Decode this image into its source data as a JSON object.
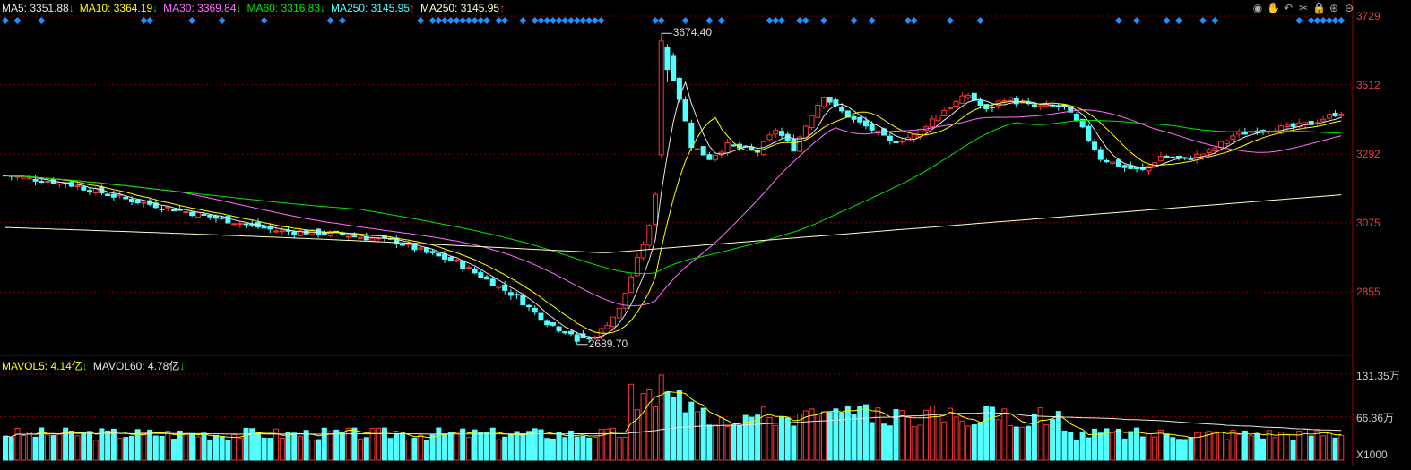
{
  "colors": {
    "up": "#ff3232",
    "down": "#54ffff",
    "ma5": "#e8e8e8",
    "ma10": "#ffff00",
    "ma30": "#ff6eff",
    "ma60": "#00e600",
    "ma250": "#ffffc8",
    "grid": "#7a0000",
    "axis": "#a00000",
    "marker": "#1e90ff"
  },
  "legend": {
    "price": [
      {
        "label": "MA5: 3351.88",
        "arrow": "↓",
        "color": "#e8e8e8"
      },
      {
        "label": "MA10: 3364.19",
        "arrow": "↓",
        "color": "#ffff00"
      },
      {
        "label": "MA30: 3369.84",
        "arrow": "↓",
        "color": "#ff6eff"
      },
      {
        "label": "MA60: 3316.83",
        "arrow": "↓",
        "color": "#00e600"
      },
      {
        "label": "MA250: 3145.95",
        "arrow": "↑",
        "color": "#54ffff"
      },
      {
        "label": "MA250: 3145.95",
        "arrow": "↑",
        "color": "#ffffc8"
      }
    ],
    "volume": [
      {
        "label": "MAVOL5: 4.14亿",
        "arrow": "↓",
        "color": "#ffff00"
      },
      {
        "label": "MAVOL60: 4.78亿",
        "arrow": "↓",
        "color": "#e8e8e8"
      }
    ]
  },
  "toolbar": [
    "eye-icon",
    "hand-icon",
    "undo-icon",
    "scissors-icon",
    "lock-icon",
    "zoom-in-icon",
    "zoom-out-icon"
  ],
  "toolbar_glyphs": [
    "◉",
    "✋",
    "↶",
    "✂",
    "🔒",
    "⊕",
    "⊖"
  ],
  "chart_data": {
    "type": "candlestick",
    "y_ticks": [
      "3729",
      "3512",
      "3292",
      "3075",
      "2855"
    ],
    "y_tick_values": [
      3729,
      3512,
      3292,
      3075,
      2855
    ],
    "ylim": [
      2655,
      3729
    ],
    "volume_ticks": [
      "131.35万",
      "66.36万",
      "X1000"
    ],
    "volume_tick_values": [
      1313.5,
      663.6
    ],
    "volume_ylim": [
      0,
      1313.5
    ],
    "annotations": [
      {
        "text": "3674.40",
        "value": 3674.4
      },
      {
        "text": "2689.70",
        "value": 2689.7
      }
    ],
    "markers_on": [
      0,
      2,
      6,
      23,
      24,
      31,
      36,
      43,
      54,
      56,
      69,
      71,
      72,
      73,
      74,
      75,
      76,
      77,
      78,
      79,
      80,
      82,
      83,
      86,
      88,
      89,
      90,
      91,
      92,
      93,
      94,
      95,
      96,
      97,
      98,
      99,
      108,
      109,
      113,
      117,
      119,
      127,
      128,
      129,
      132,
      133,
      136,
      141,
      144,
      150,
      151,
      157,
      162,
      185,
      188,
      193,
      195,
      199,
      201,
      215,
      217,
      218,
      219,
      220,
      221,
      222
    ]
  }
}
